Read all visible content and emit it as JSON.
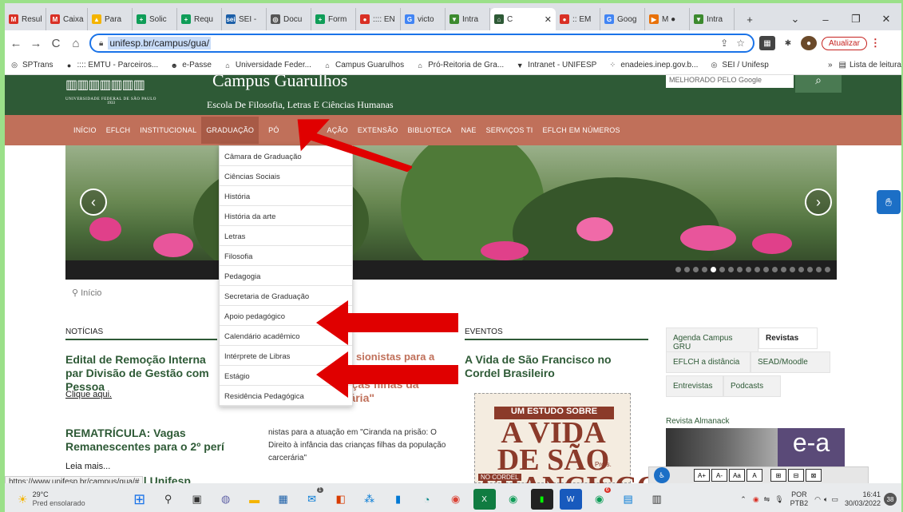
{
  "browser": {
    "tabs": [
      {
        "label": "Resul",
        "icon": "gmail-icon",
        "color": "#d93025",
        "glyph": "M"
      },
      {
        "label": "Caixa",
        "icon": "gmail-icon",
        "color": "#d93025",
        "glyph": "M"
      },
      {
        "label": "Para",
        "icon": "drive-icon",
        "color": "#f4b400",
        "glyph": "▲"
      },
      {
        "label": "Solic",
        "icon": "sheets-icon",
        "color": "#0f9d58",
        "glyph": "+"
      },
      {
        "label": "Requ",
        "icon": "sheets-icon",
        "color": "#0f9d58",
        "glyph": "+"
      },
      {
        "label": "SEI -",
        "icon": "sei-icon",
        "color": "#1c5fa8",
        "glyph": "sei"
      },
      {
        "label": "Docu",
        "icon": "globe-icon",
        "color": "#555555",
        "glyph": "◎"
      },
      {
        "label": "Form",
        "icon": "sheets-icon",
        "color": "#0f9d58",
        "glyph": "+"
      },
      {
        "label": ":::: EN",
        "icon": "emtu-icon",
        "color": "#d93025",
        "glyph": "●"
      },
      {
        "label": "victo",
        "icon": "google-icon",
        "color": "#4285f4",
        "glyph": "G"
      },
      {
        "label": "Intra",
        "icon": "intranet-icon",
        "color": "#3c8a2e",
        "glyph": "▼"
      },
      {
        "label": "C",
        "icon": "unifesp-icon",
        "color": "#2e5a36",
        "glyph": "⌂"
      },
      {
        "label": ":: EM",
        "icon": "emtu-icon",
        "color": "#d93025",
        "glyph": "●"
      },
      {
        "label": "Goog",
        "icon": "google-icon",
        "color": "#4285f4",
        "glyph": "G"
      },
      {
        "label": "M ●",
        "icon": "media-icon",
        "color": "#e8710a",
        "glyph": "▶"
      },
      {
        "label": "Intra",
        "icon": "intranet-icon",
        "color": "#3c8a2e",
        "glyph": "▼"
      }
    ],
    "new_tab": "+",
    "url_prefix": "unifesp.br/campus/gua/",
    "update_label": "Atualizar",
    "bookmarks": [
      {
        "label": "SPTrans",
        "glyph": "◎"
      },
      {
        "label": ":::: EMTU - Parceiros...",
        "glyph": "●"
      },
      {
        "label": "e-Passe",
        "glyph": "☻"
      },
      {
        "label": "Universidade Feder...",
        "glyph": "⌂"
      },
      {
        "label": "Campus Guarulhos",
        "glyph": "⌂"
      },
      {
        "label": "Pró-Reitoria de Gra...",
        "glyph": "⌂"
      },
      {
        "label": "Intranet - UNIFESP",
        "glyph": "▼"
      },
      {
        "label": "enadeies.inep.gov.b...",
        "glyph": "⁘"
      },
      {
        "label": "SEI / Unifesp",
        "glyph": "◎"
      }
    ],
    "more_bookmarks": "»",
    "reading_list": "Lista de leitura",
    "status_url": "https://www.unifesp.br/campus/gua/#"
  },
  "site": {
    "university": "UNIVERSIDADE FEDERAL DE SÃO PAULO",
    "founded": "1933",
    "campus": "Campus Guarulhos",
    "school": "Escola De Filosofia, Letras E Ciências Humanas",
    "search_hint": "MELHORADO PELO Google",
    "menu": [
      "INÍCIO",
      "EFLCH",
      "INSTITUCIONAL",
      "GRADUAÇÃO",
      "PÓS-GRADUAÇÃO",
      "EXTENSÃO",
      "BIBLIOTECA",
      "NAE",
      "SERVIÇOS TI",
      "EFLCH EM NÚMEROS"
    ],
    "menu_visible": [
      "INÍCIO",
      "EFLCH",
      "INSTITUCIONAL",
      "GRADUAÇÃO",
      "PÓ",
      "AÇÃO",
      "EXTENSÃO",
      "BIBLIOTECA",
      "NAE",
      "SERVIÇOS TI",
      "EFLCH EM NÚMEROS"
    ],
    "breadcrumb": "Início",
    "dropdown": [
      "Câmara de Graduação",
      "Ciências Sociais",
      "História",
      "História da arte",
      "Letras",
      "Filosofia",
      "Pedagogia",
      "Secretaria de Graduação",
      "Apoio pedagógico",
      "Calendário acadêmico",
      "Intérprete de Libras",
      "Estágio",
      "Residência Pedagógica"
    ],
    "news": {
      "heading": "NOTÍCIAS",
      "item1_title": "Edital de Remoção Interna par Divisão de Gestão com Pessoa",
      "item1_link": "Clique aqui",
      "item1_dot": ".",
      "item2_title": "REMATRÍCULA: Vagas Remanescentes para o 2º perí",
      "item2_link": "Leia mais...",
      "item3_title": "encial Unifesp"
    },
    "middle": {
      "title_fragment": "o: O Direito à nças filhas da rária\"",
      "title_top": "sionistas para a",
      "text": "nistas para a atuação em \"Ciranda na prisão: O Direito à infância das crianças filhas da população carcerária\""
    },
    "events": {
      "heading": "EVENTOS",
      "title": "A Vida de São Francisco no Cordel Brasileiro",
      "cordel_banner": "UM ESTUDO SOBRE",
      "cordel_title": "A VIDA DE SÃO FRANCISCO",
      "cordel_foot": "NO CORDEL",
      "cordel_profs": "Profs."
    },
    "right_tabs": [
      "Agenda Campus GRU",
      "Revistas",
      "EFLCH a distância",
      "SEAD/Moodle",
      "Entrevistas",
      "Podcasts"
    ],
    "right_selected": "Revistas",
    "almanack": "Revista Almanack",
    "almanack_letters": "e-a"
  },
  "access_bar": [
    "A+",
    "A-",
    "Aa",
    "A",
    "⊞",
    "⊟",
    "⊠"
  ],
  "taskbar": {
    "temp": "29°C",
    "weather": "Pred ensolarado",
    "lang": "POR",
    "layout": "PTB2",
    "time": "16:41",
    "date": "30/03/2022",
    "notif": "38",
    "outlook_badge": "1",
    "chrome_badge": "6"
  },
  "colors": {
    "header_green": "#2e5a36",
    "menu_salmon": "#c0705a",
    "arrow_red": "#e00000",
    "frame_green": "#9be089"
  }
}
